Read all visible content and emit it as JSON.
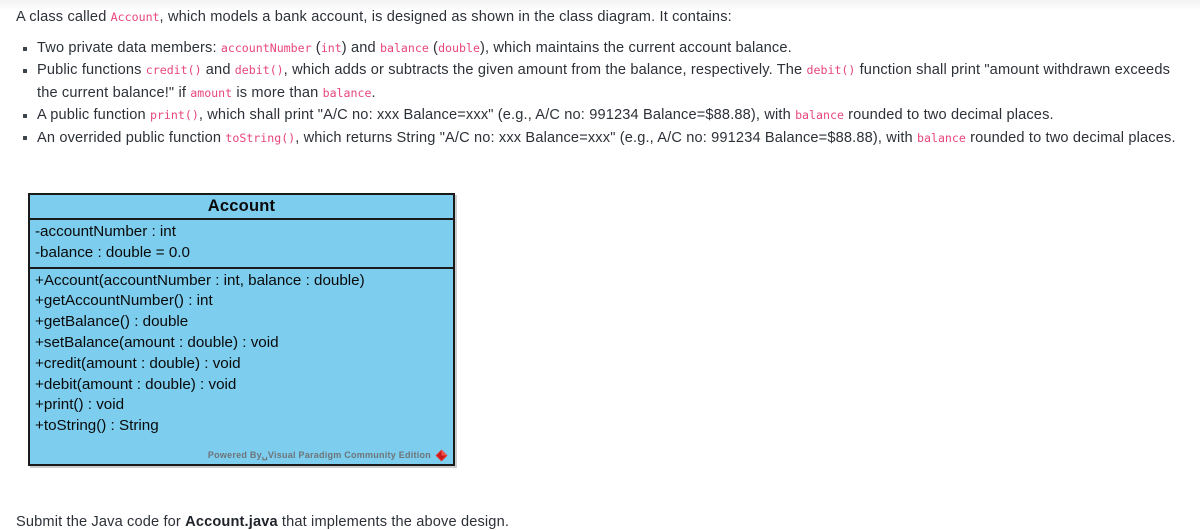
{
  "document": {
    "intro": {
      "part1": "A class called ",
      "code1": "Account",
      "part2": ", which models a bank account, is designed as shown in the class diagram. It contains:"
    },
    "bullets": [
      {
        "id": "bullet-data-members",
        "segments": [
          {
            "type": "text",
            "value": "Two private data members: "
          },
          {
            "type": "code",
            "value": "accountNumber"
          },
          {
            "type": "text",
            "value": " ("
          },
          {
            "type": "code",
            "value": "int"
          },
          {
            "type": "text",
            "value": ") and "
          },
          {
            "type": "code",
            "value": "balance"
          },
          {
            "type": "text",
            "value": " ("
          },
          {
            "type": "code",
            "value": "double"
          },
          {
            "type": "text",
            "value": "), which maintains the current account balance."
          }
        ]
      },
      {
        "id": "bullet-credit-debit",
        "segments": [
          {
            "type": "text",
            "value": "Public functions "
          },
          {
            "type": "code",
            "value": "credit()"
          },
          {
            "type": "text",
            "value": " and "
          },
          {
            "type": "code",
            "value": "debit()"
          },
          {
            "type": "text",
            "value": ", which adds or subtracts the given amount from the balance, respectively. The "
          },
          {
            "type": "code",
            "value": "debit()"
          },
          {
            "type": "text",
            "value": " function shall print \"amount withdrawn exceeds the current balance!\" if "
          },
          {
            "type": "code",
            "value": "amount"
          },
          {
            "type": "text",
            "value": " is more than "
          },
          {
            "type": "code",
            "value": "balance"
          },
          {
            "type": "text",
            "value": "."
          }
        ]
      },
      {
        "id": "bullet-print",
        "segments": [
          {
            "type": "text",
            "value": "A public function "
          },
          {
            "type": "code",
            "value": "print()"
          },
          {
            "type": "text",
            "value": ", which shall print \"A/C no: xxx Balance=xxx\" (e.g., A/C no: 991234 Balance=$88.88), with "
          },
          {
            "type": "code",
            "value": "balance"
          },
          {
            "type": "text",
            "value": " rounded to two decimal places."
          }
        ]
      },
      {
        "id": "bullet-tostring",
        "segments": [
          {
            "type": "text",
            "value": "An overrided public function "
          },
          {
            "type": "code",
            "value": "toString()"
          },
          {
            "type": "text",
            "value": ", which returns String \"A/C no: xxx Balance=xxx\" (e.g., A/C no: 991234 Balance=$88.88), with "
          },
          {
            "type": "code",
            "value": "balance"
          },
          {
            "type": "text",
            "value": " rounded to two decimal places."
          }
        ]
      }
    ],
    "outro": {
      "part1": "Submit the Java code for ",
      "bold": "Account.java",
      "part2": " that implements the above design."
    }
  },
  "class_diagram": {
    "class_name": "Account",
    "attributes": [
      "-accountNumber : int",
      "-balance : double = 0.0"
    ],
    "operations": [
      "+Account(accountNumber : int, balance : double)",
      "+getAccountNumber() : int",
      "+getBalance() : double",
      "+setBalance(amount : double) : void",
      "+credit(amount : double) : void",
      "+debit(amount : double) : void",
      "+print() : void",
      "+toString() : String"
    ],
    "watermark": "Powered By␣Visual Paradigm Community Edition",
    "colors": {
      "fill": "#7ccdee",
      "border": "#1a1a1a",
      "watermark_text": "#6e7478",
      "watermark_icon": "#e52421"
    }
  },
  "theme": {
    "background": "#ffffff",
    "body_text": "#2c3138",
    "inline_code": "#e8467c"
  }
}
